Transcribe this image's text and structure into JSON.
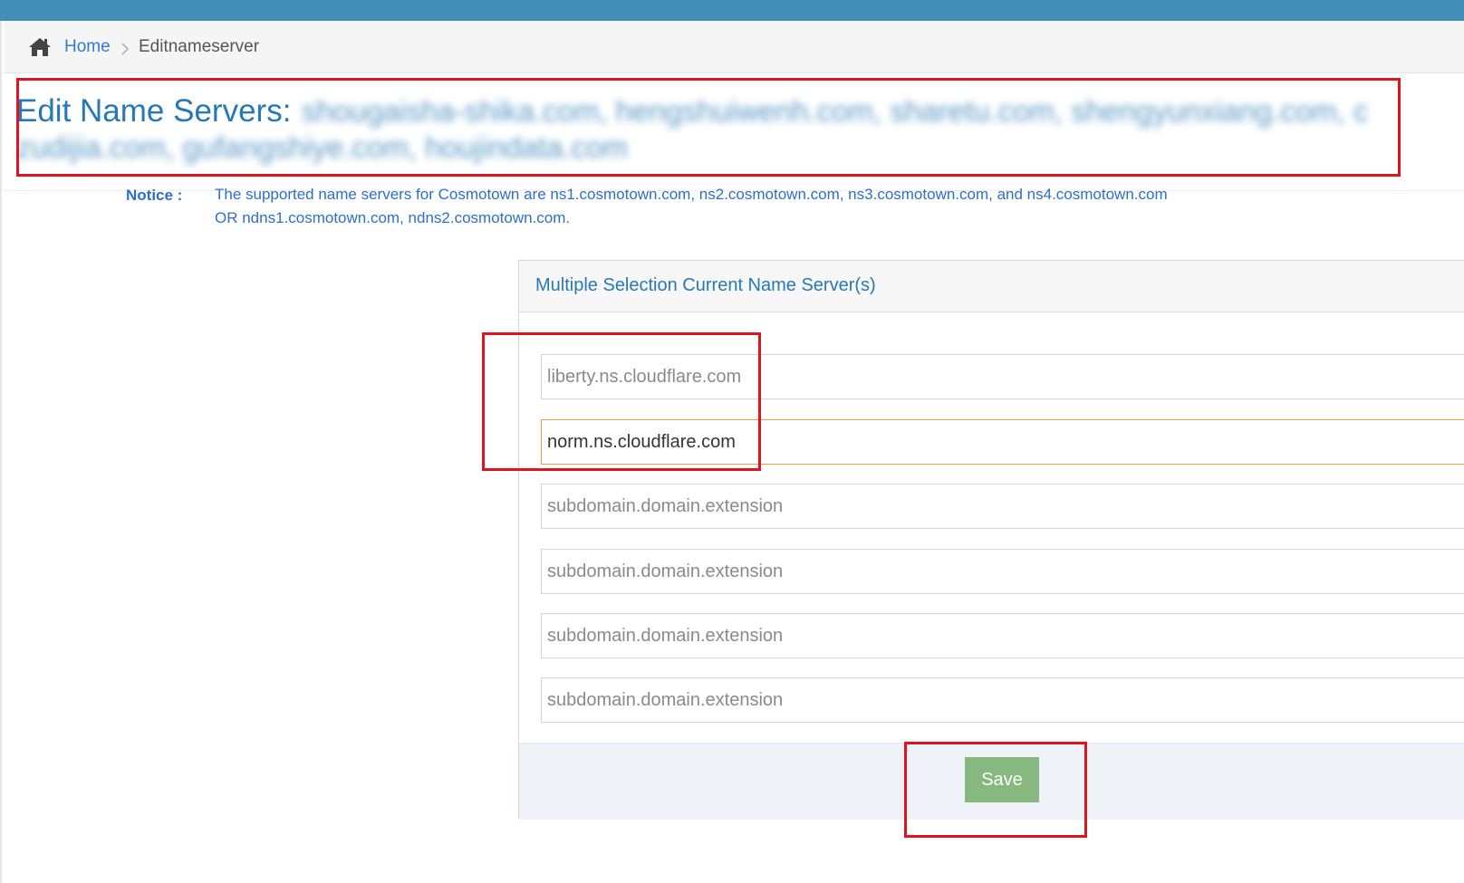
{
  "breadcrumb": {
    "home_label": "Home",
    "separator": ">",
    "current_label": "Editnameserver"
  },
  "header": {
    "title": "Edit Name Servers: ",
    "domains_blurred": "shougaisha-shika.com, hengshuiwenh.com, sharetu.com, shengyunxiang.com, c zudijia.com, gufangshiye.com, houjindata.com"
  },
  "notice": {
    "label": "Notice :",
    "line1": "The supported name servers for Cosmotown are ns1.cosmotown.com, ns2.cosmotown.com, ns3.cosmotown.com, and ns4.cosmotown.com",
    "line2": "OR ndns1.cosmotown.com, ndns2.cosmotown.com."
  },
  "widget": {
    "title": "Multiple Selection Current Name Server(s)",
    "inputs": [
      {
        "value": "",
        "placeholder": "liberty.ns.cloudflare.com"
      },
      {
        "value": "norm.ns.cloudflare.com",
        "placeholder": ""
      },
      {
        "value": "",
        "placeholder": "subdomain.domain.extension"
      },
      {
        "value": "",
        "placeholder": "subdomain.domain.extension"
      },
      {
        "value": "",
        "placeholder": "subdomain.domain.extension"
      },
      {
        "value": "",
        "placeholder": "subdomain.domain.extension"
      }
    ],
    "save_label": "Save"
  },
  "colors": {
    "topbar": "#438eb9",
    "title": "#2679b5",
    "notice": "#2e6fc7",
    "save_button": "#87b87f",
    "highlight": "#e0141e",
    "focus_border": "#f59942"
  },
  "icons": {
    "home": "home-icon"
  }
}
